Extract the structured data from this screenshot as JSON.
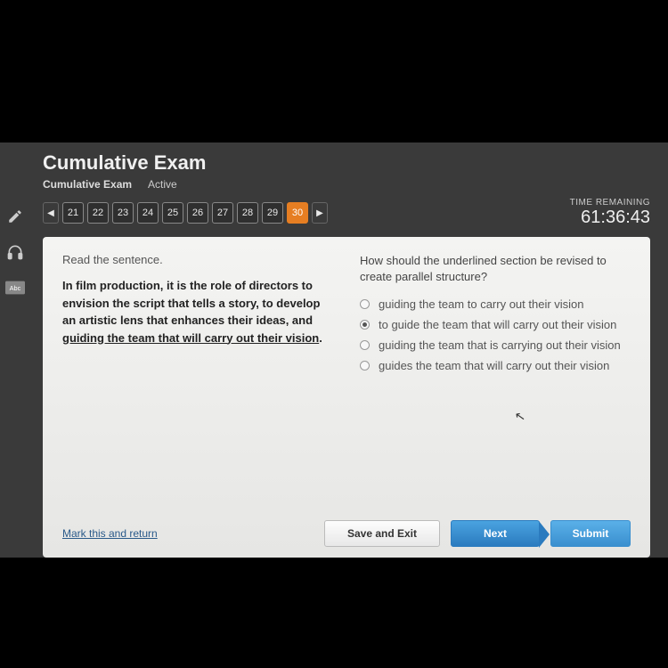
{
  "header": {
    "title": "Cumulative Exam",
    "subtitle": "Cumulative Exam",
    "status": "Active"
  },
  "nav": {
    "prev_glyph": "◀",
    "next_glyph": "▶",
    "questions": [
      "21",
      "22",
      "23",
      "24",
      "25",
      "26",
      "27",
      "28",
      "29",
      "30"
    ],
    "active_index": 9
  },
  "timer": {
    "label": "TIME REMAINING",
    "value": "61:36:43"
  },
  "left": {
    "instruction": "Read the sentence.",
    "passage_pre": "In film production, it is the role of directors to envision the script that tells a story, to develop an artistic lens that enhances their ideas, and ",
    "passage_under": "guiding the team that will carry out their vision",
    "passage_post": "."
  },
  "right": {
    "question": "How should the underlined section be revised to create parallel structure?",
    "options": [
      {
        "text": "guiding the team to carry out their vision",
        "selected": false
      },
      {
        "text": "to guide the team that will carry out their vision",
        "selected": true
      },
      {
        "text": "guiding the team that is carrying out their vision",
        "selected": false
      },
      {
        "text": "guides the team that will carry out their vision",
        "selected": false
      }
    ]
  },
  "footer": {
    "mark": "Mark this and return",
    "save": "Save and Exit",
    "next": "Next",
    "submit": "Submit"
  },
  "sidebar_icons": [
    "pencil-icon",
    "headphones-icon",
    "abc-icon"
  ]
}
